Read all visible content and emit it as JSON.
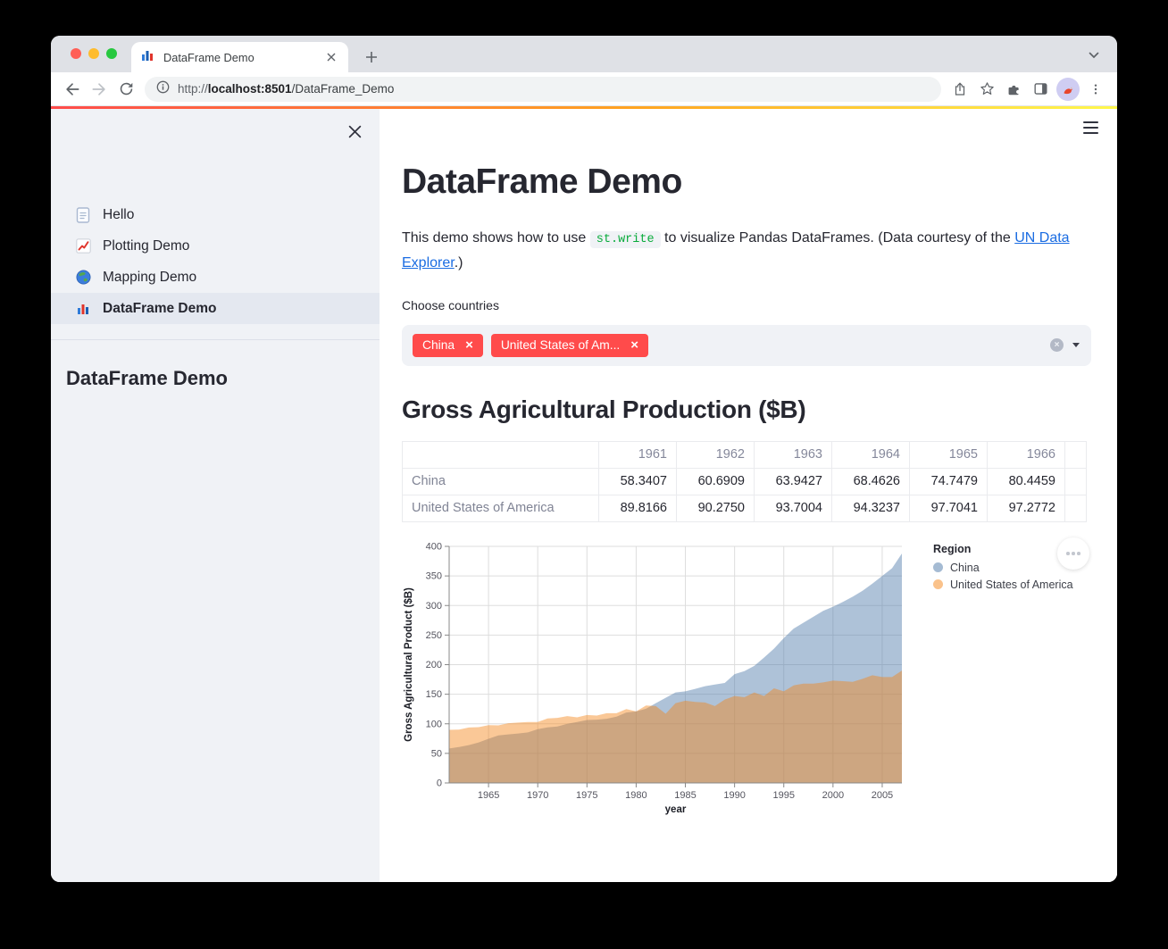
{
  "colors": {
    "accent_red": "#ff4b4b",
    "code_green": "#09ab3b",
    "link_blue": "#1a6ce2",
    "decoration_left": "#ff4b4b",
    "decoration_mid": "#ffa421",
    "decoration_right": "#fff84d"
  },
  "browser": {
    "tab_title": "DataFrame Demo",
    "url_scheme": "http://",
    "url_host": "localhost:8501",
    "url_path": "/DataFrame_Demo"
  },
  "sidebar": {
    "items": [
      {
        "label": "Hello",
        "icon": "document-icon"
      },
      {
        "label": "Plotting Demo",
        "icon": "line-chart-icon"
      },
      {
        "label": "Mapping Demo",
        "icon": "globe-icon"
      },
      {
        "label": "DataFrame Demo",
        "icon": "bar-chart-icon"
      }
    ],
    "active_index": 3,
    "heading": "DataFrame Demo"
  },
  "main": {
    "title": "DataFrame Demo",
    "intro": {
      "part1": "This demo shows how to use ",
      "code": "st.write",
      "part2": " to visualize Pandas DataFrames. (Data courtesy of the ",
      "link": "UN Data Explorer",
      "part3": ".)"
    },
    "multiselect": {
      "label": "Choose countries",
      "selected": [
        {
          "label": "China"
        },
        {
          "label": "United States of Am..."
        }
      ]
    },
    "section_title": "Gross Agricultural Production ($B)",
    "table": {
      "columns": [
        "",
        "1961",
        "1962",
        "1963",
        "1964",
        "1965",
        "1966"
      ],
      "rows": [
        {
          "label": "China",
          "values": [
            "58.3407",
            "60.6909",
            "63.9427",
            "68.4626",
            "74.7479",
            "80.4459"
          ]
        },
        {
          "label": "United States of America",
          "values": [
            "89.8166",
            "90.2750",
            "93.7004",
            "94.3237",
            "97.7041",
            "97.2772"
          ]
        }
      ]
    }
  },
  "chart_data": {
    "type": "area",
    "title": "",
    "xlabel": "year",
    "ylabel": "Gross Agricultural Product ($B)",
    "legend_title": "Region",
    "legend_position": "right",
    "grid": true,
    "overlap_opacity": 0.45,
    "xlim": [
      1961,
      2007
    ],
    "ylim": [
      0,
      400
    ],
    "x_ticks": [
      1965,
      1970,
      1975,
      1980,
      1985,
      1990,
      1995,
      2000,
      2005
    ],
    "y_ticks": [
      0,
      50,
      100,
      150,
      200,
      250,
      300,
      350,
      400
    ],
    "x": [
      1961,
      1962,
      1963,
      1964,
      1965,
      1966,
      1967,
      1968,
      1969,
      1970,
      1971,
      1972,
      1973,
      1974,
      1975,
      1976,
      1977,
      1978,
      1979,
      1980,
      1981,
      1982,
      1983,
      1984,
      1985,
      1986,
      1987,
      1988,
      1989,
      1990,
      1991,
      1992,
      1993,
      1994,
      1995,
      1996,
      1997,
      1998,
      1999,
      2000,
      2001,
      2002,
      2003,
      2004,
      2005,
      2006,
      2007
    ],
    "series": [
      {
        "name": "China",
        "color": "#4c78a8",
        "values": [
          58.3407,
          60.6909,
          63.9427,
          68.4626,
          74.7479,
          80.4459,
          82,
          83.5,
          85.5,
          91,
          94,
          95.5,
          100,
          103,
          106.5,
          107,
          108.5,
          112,
          119,
          121,
          125.5,
          135,
          144,
          153,
          155,
          159,
          163.5,
          166.5,
          169,
          184,
          189,
          198,
          212,
          227,
          245,
          261,
          271,
          281,
          291,
          298,
          306,
          315,
          325,
          337,
          350,
          363,
          388
        ]
      },
      {
        "name": "United States of America",
        "color": "#f58518",
        "values": [
          89.8166,
          90.275,
          93.7004,
          94.3237,
          97.7041,
          97.2772,
          101,
          102,
          103,
          103,
          109,
          110,
          113,
          111,
          115,
          114,
          118,
          118,
          125,
          121,
          131,
          130,
          117,
          135,
          139,
          137,
          136,
          130,
          141,
          147,
          145,
          153,
          147,
          160,
          155,
          165,
          168,
          168,
          170,
          173,
          172,
          171,
          176,
          182,
          179,
          179,
          190
        ]
      }
    ]
  }
}
